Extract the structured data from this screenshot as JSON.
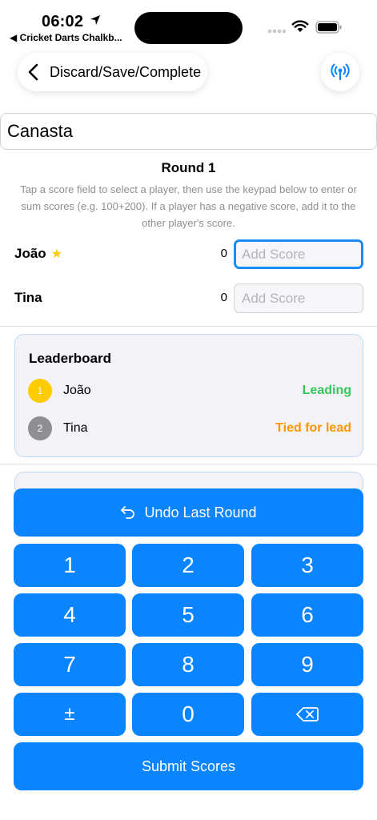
{
  "status_bar": {
    "time": "06:02",
    "back_app": "◀ Cricket Darts Chalkb..."
  },
  "nav": {
    "title": "Discard/Save/Complete"
  },
  "game": {
    "name": "Canasta",
    "round_title": "Round 1",
    "instructions": "Tap a score field to select a player, then use the keypad below to enter or sum scores (e.g. 100+200). If a player has a negative score, add it to the other player's score."
  },
  "players": [
    {
      "name": "João",
      "leader_star": "★",
      "score": "0",
      "placeholder": "Add Score"
    },
    {
      "name": "Tina",
      "score": "0",
      "placeholder": "Add Score"
    }
  ],
  "leaderboard": {
    "title": "Leaderboard",
    "rows": [
      {
        "rank": "1",
        "name": "João",
        "status": "Leading",
        "badge_color": "#ffcc00",
        "status_color": "#34c759"
      },
      {
        "rank": "2",
        "name": "Tina",
        "status": "Tied for lead",
        "badge_color": "#8e8e93",
        "status_color": "#ff9500"
      }
    ]
  },
  "keypad": {
    "undo_label": "Undo Last Round",
    "keys": [
      "1",
      "2",
      "3",
      "4",
      "5",
      "6",
      "7",
      "8",
      "9",
      "±",
      "0"
    ],
    "backspace_icon": "delete-left-icon",
    "submit_label": "Submit Scores"
  },
  "colors": {
    "accent": "#0a84ff",
    "leading": "#34c759",
    "tied": "#ff9500"
  }
}
